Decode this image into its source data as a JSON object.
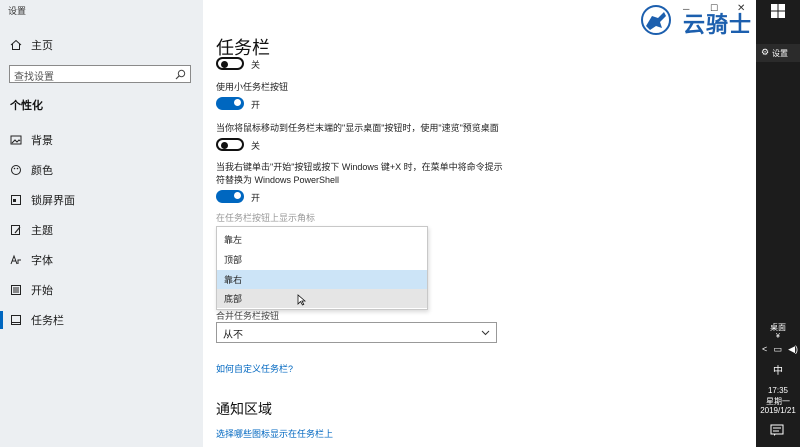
{
  "window": {
    "title": "设置"
  },
  "watermark": {
    "text": "云骑士"
  },
  "sidebar": {
    "home_label": "主页",
    "search_placeholder": "查找设置",
    "section": "个性化",
    "items": [
      {
        "label": "背景",
        "icon": "image-icon"
      },
      {
        "label": "颜色",
        "icon": "palette-icon"
      },
      {
        "label": "锁屏界面",
        "icon": "lock-screen-icon"
      },
      {
        "label": "主题",
        "icon": "brush-icon"
      },
      {
        "label": "字体",
        "icon": "font-icon"
      },
      {
        "label": "开始",
        "icon": "start-icon"
      },
      {
        "label": "任务栏",
        "icon": "taskbar-icon",
        "active": true
      }
    ]
  },
  "main": {
    "title": "任务栏",
    "settings": [
      {
        "label": "",
        "state": "关",
        "on": false
      },
      {
        "label": "使用小任务栏按钮",
        "state": "开",
        "on": true
      },
      {
        "label": "当你将鼠标移动到任务栏末端的\"显示桌面\"按钮时，使用\"速览\"预览桌面",
        "state": "关",
        "on": false
      },
      {
        "label": "当我右键单击\"开始\"按钮或按下 Windows 键+X 时，在菜单中将命令提示符替换为 Windows PowerShell",
        "state": "开",
        "on": true
      }
    ],
    "badge_label": "在任务栏按钮上显示角标",
    "dropdown_options": [
      "靠左",
      "顶部",
      "靠右",
      "底部"
    ],
    "dropdown_selected": "靠右",
    "dropdown_hovered": "底部",
    "combine_label": "合并任务栏按钮",
    "combine_value": "从不",
    "customize_link": "如何自定义任务栏?",
    "notify_section": "通知区域",
    "notify_link": "选择哪些图标显示在任务栏上"
  },
  "taskbar": {
    "settings_label": "设置",
    "desktop_label": "桌面",
    "ime": "中",
    "time": "17:35",
    "weekday": "星期一",
    "date": "2019/1/21"
  },
  "colors": {
    "accent": "#0067c0",
    "sidebar_bg": "#eceff2",
    "taskbar_bg": "#1c1c1c",
    "selected": "#cce4f7"
  }
}
